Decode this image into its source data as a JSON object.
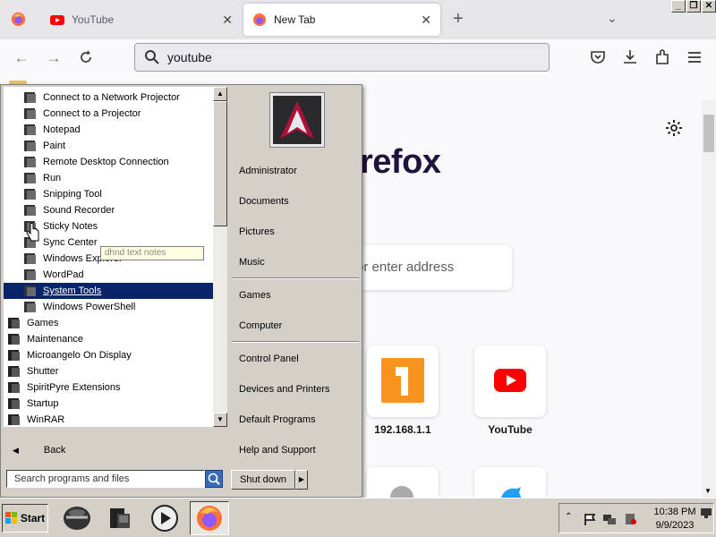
{
  "browser": {
    "tabs": [
      {
        "label": "YouTube",
        "active": false
      },
      {
        "label": "New Tab",
        "active": true
      }
    ],
    "new_tab_symbol": "+",
    "close_symbol": "✕",
    "url_text": "youtube",
    "window_controls": [
      "_",
      "❐",
      "✕"
    ]
  },
  "newtab": {
    "brand_fragment": "refox",
    "search_placeholder_fragment": "or enter address",
    "shortcuts": [
      {
        "label": "192.168.1.1",
        "icon": "orange-1-icon"
      },
      {
        "label": "YouTube",
        "icon": "youtube-icon"
      }
    ]
  },
  "start_menu": {
    "programs": [
      {
        "label": "Connect to a Network Projector",
        "icon": "projector-icon"
      },
      {
        "label": "Connect to a Projector",
        "icon": "monitor-icon"
      },
      {
        "label": "Notepad",
        "icon": "notepad-icon"
      },
      {
        "label": "Paint",
        "icon": "paint-icon"
      },
      {
        "label": "Remote Desktop Connection",
        "icon": "remote-desktop-icon"
      },
      {
        "label": "Run",
        "icon": "run-icon"
      },
      {
        "label": "Snipping Tool",
        "icon": "snipping-icon"
      },
      {
        "label": "Sound Recorder",
        "icon": "microphone-icon"
      },
      {
        "label": "Sticky Notes",
        "icon": "sticky-notes-icon"
      },
      {
        "label": "Sync Center",
        "icon": "sync-icon"
      },
      {
        "label": "Windows Explorer",
        "icon": "folder-icon"
      },
      {
        "label": "WordPad",
        "icon": "wordpad-icon"
      },
      {
        "label": "System Tools",
        "icon": "folder-icon",
        "selected": true
      },
      {
        "label": "Windows PowerShell",
        "icon": "folder-icon"
      }
    ],
    "folders": [
      {
        "label": "Games"
      },
      {
        "label": "Maintenance"
      },
      {
        "label": "Microangelo On Display"
      },
      {
        "label": "Shutter"
      },
      {
        "label": "SpiritPyre Extensions"
      },
      {
        "label": "Startup"
      },
      {
        "label": "WinRAR"
      }
    ],
    "tooltip": "dhnd text notes",
    "back_label": "Back",
    "search_placeholder": "Search programs and files",
    "right_items": [
      {
        "label": "Administrator"
      },
      {
        "label": "Documents"
      },
      {
        "label": "Pictures"
      },
      {
        "label": "Music"
      },
      {
        "label": "Games"
      },
      {
        "label": "Computer"
      },
      {
        "label": "Control Panel"
      },
      {
        "label": "Devices and Printers"
      },
      {
        "label": "Default Programs"
      },
      {
        "label": "Help and Support"
      }
    ],
    "shutdown_label": "Shut down"
  },
  "taskbar": {
    "start_label": "Start",
    "clock_time": "10:38 PM",
    "clock_date": "9/9/2023"
  },
  "colors": {
    "selection": "#0a246a",
    "classic_gray": "#d4d0c8",
    "firefox_orange": "#ff7139",
    "youtube_red": "#ff0000"
  }
}
